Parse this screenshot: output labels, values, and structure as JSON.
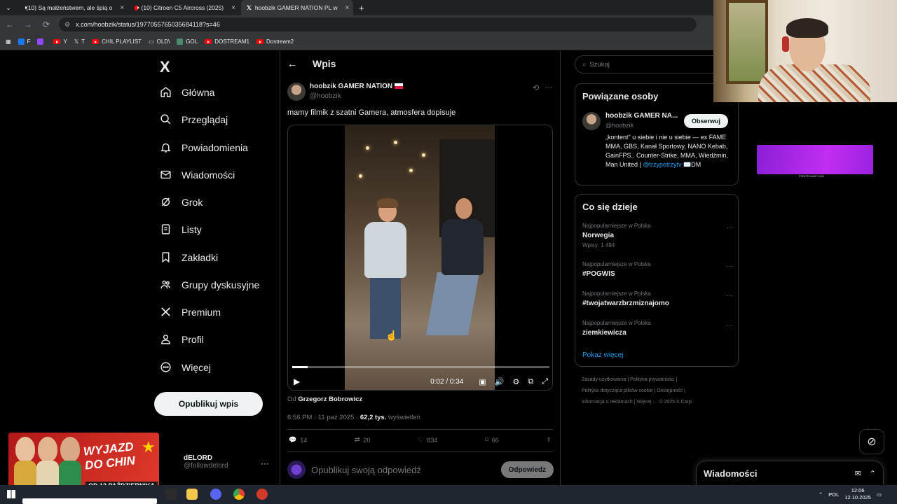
{
  "browser": {
    "tabs": [
      {
        "title": "(10) Są małżeństwem, ale śpią o",
        "icon": "youtube"
      },
      {
        "title": "(10) Citroen C5 Aircross (2025)",
        "icon": "youtube"
      },
      {
        "title": "hoobzik GAMER NATION PL w",
        "icon": "x"
      }
    ],
    "new_tab": "+",
    "url": "x.com/hoobzik/status/1977055765035684118?s=46",
    "bookmarks": [
      "F",
      "",
      "Y",
      "T",
      "CHIL PLAYLIST",
      "OLD\\",
      "GOL",
      "DOSTREAM1",
      "Dostream2"
    ]
  },
  "nav": {
    "logo": "X",
    "items": [
      "Główna",
      "Przeglądaj",
      "Powiadomienia",
      "Wiadomości",
      "Grok",
      "Listy",
      "Zakładki",
      "Grupy dyskusyjne",
      "Premium",
      "Profil",
      "Więcej"
    ],
    "post_button": "Opublikuj wpis",
    "account_name": "dELORD",
    "account_handle": "@followdelord",
    "account_more": "···"
  },
  "promo": {
    "title_line1": "WYJAZD",
    "title_line2": "DO CHIN",
    "date": "OD 13 PAŹDZIERNIKA"
  },
  "post": {
    "header": "Wpis",
    "author_name": "hoobzik GAMER NATION",
    "author_handle": "@hoobzik",
    "text": "mamy filmik z szatni Gamera, atmosfera dopisuje",
    "video_time": "0:02 / 0:34",
    "video_progress": 0.06,
    "byline_prefix": "Od",
    "byline_name": "Grzegorz Bobrowicz",
    "timestamp": "6:56 PM · 11 paź 2025 ·",
    "views_count": "62,2 tys.",
    "views_label": "wyświetleń",
    "stats": {
      "replies": "14",
      "reposts": "20",
      "likes": "834",
      "bookmarks": "66"
    },
    "reply_placeholder": "Opublikuj swoją odpowiedź",
    "reply_button": "Odpowiedz"
  },
  "sidebar": {
    "search_placeholder": "Szukaj",
    "related_title": "Powiązane osoby",
    "related_name": "hoobzik GAMER NA...",
    "related_handle": "@hoobzik",
    "follow_button": "Obserwuj",
    "bio": "„kontent\" u siebie i nie u siebie — ex FAME MMA, GBS, Kanał Sportowy, NANO Kebab, GainFPS.. Counter-Strike, MMA, Wiedźmin, Man United |",
    "bio_link": "@trzypotrzytv",
    "bio_suffix": "✉️DM",
    "trends_title": "Co się dzieje",
    "trends": [
      {
        "category": "Najpopularniejsze w Polska",
        "name": "Norwegia",
        "count": "Wpisy: 1 494"
      },
      {
        "category": "Najpopularniejsze w Polska",
        "name": "#POGWIS",
        "count": ""
      },
      {
        "category": "Najpopularniejsze w Polska",
        "name": "#twojatwarzbrzmiznajomo",
        "count": ""
      },
      {
        "category": "Najpopularniejsze w Polska",
        "name": "ziemkiewicza",
        "count": ""
      }
    ],
    "show_more": "Pokaż więcej",
    "footer_line1": "Zasady użytkowania | Polityka prywatności |",
    "footer_line2": "Polityka dotycząca plików cookie | Dostępność |",
    "footer_line3": "Informacja o reklamach | Więcej ··· © 2025 X Corp."
  },
  "ad": {
    "caption": "PIRATESWAP.COM"
  },
  "messages": {
    "title": "Wiadomości"
  },
  "taskbar": {
    "lang": "POL",
    "time": "12:06",
    "date": "12.10.2025"
  },
  "colors": {
    "accent": "#1d9bf0",
    "bg": "#000000",
    "border": "#2f3336",
    "muted": "#71767b"
  }
}
